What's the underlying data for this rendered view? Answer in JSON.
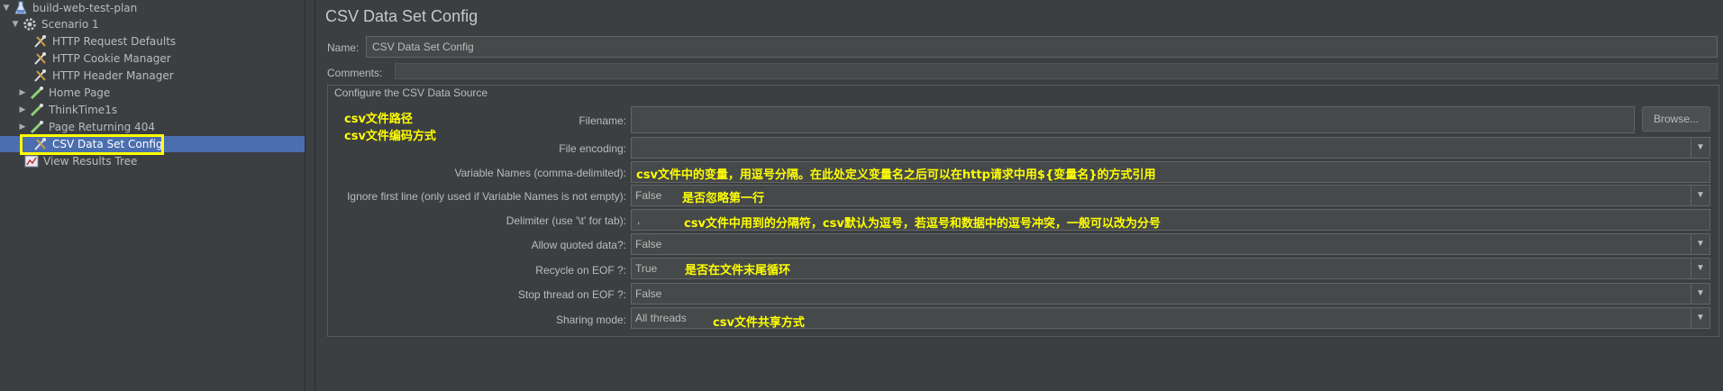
{
  "tree": {
    "items": [
      {
        "label": "build-web-test-plan",
        "icon": "test-plan-icon",
        "expander": "▼"
      },
      {
        "label": "Scenario 1",
        "icon": "thread-group-icon",
        "expander": "▼"
      },
      {
        "label": "HTTP Request Defaults",
        "icon": "config-element-icon",
        "expander": ""
      },
      {
        "label": "HTTP Cookie Manager",
        "icon": "config-element-icon",
        "expander": ""
      },
      {
        "label": "HTTP Header Manager",
        "icon": "config-element-icon",
        "expander": ""
      },
      {
        "label": "Home Page",
        "icon": "sampler-icon",
        "expander": "▶"
      },
      {
        "label": "ThinkTime1s",
        "icon": "sampler-icon",
        "expander": "▶"
      },
      {
        "label": "Page Returning 404",
        "icon": "sampler-icon",
        "expander": "▶"
      },
      {
        "label": "CSV Data Set Config",
        "icon": "config-element-icon",
        "expander": ""
      },
      {
        "label": "View Results Tree",
        "icon": "listener-icon",
        "expander": ""
      }
    ]
  },
  "panel": {
    "title": "CSV Data Set Config",
    "name_label": "Name:",
    "name_value": "CSV Data Set Config",
    "comments_label": "Comments:",
    "group_title": "Configure the CSV Data Source",
    "filename_label": "Filename:",
    "browse_label": "Browse...",
    "file_encoding_label": "File encoding:",
    "variable_names_label": "Variable Names (comma-delimited):",
    "ignore_first_line_label": "Ignore first line (only used if Variable Names is not empty):",
    "ignore_first_line_value": "False",
    "delimiter_label": "Delimiter (use '\\t' for tab):",
    "delimiter_value": ",",
    "allow_quoted_label": "Allow quoted data?:",
    "allow_quoted_value": "False",
    "recycle_label": "Recycle on EOF ?:",
    "recycle_value": "True",
    "stop_thread_label": "Stop thread on EOF ?:",
    "stop_thread_value": "False",
    "sharing_label": "Sharing mode:",
    "sharing_value": "All threads"
  },
  "notes": {
    "filename": "csv文件路径",
    "encoding": "csv文件编码方式",
    "variable_names": "csv文件中的变量，用逗号分隔。在此处定义变量名之后可以在http请求中用${变量名}的方式引用",
    "ignore_first_line": "是否忽略第一行",
    "delimiter": "csv文件中用到的分隔符，csv默认为逗号，若逗号和数据中的逗号冲突，一般可以改为分号",
    "recycle": "是否在文件末尾循环",
    "sharing": "csv文件共享方式"
  },
  "colors": {
    "background": "#3c3f41",
    "selection": "#4b6eaf",
    "highlight": "#ffff00",
    "annotation": "#ffff00"
  }
}
